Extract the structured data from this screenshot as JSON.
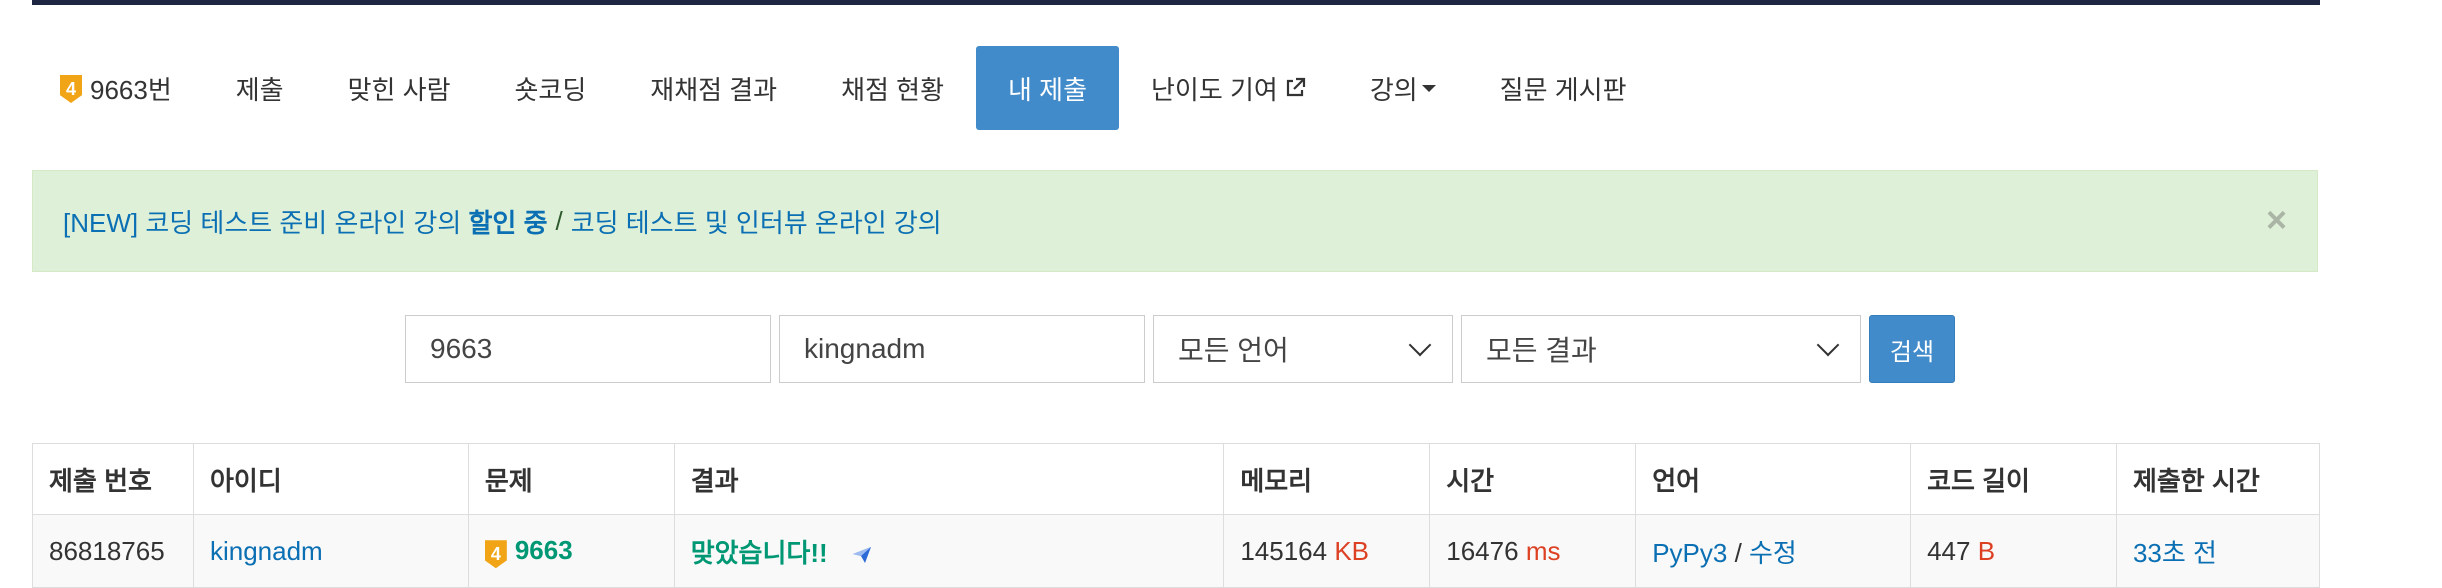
{
  "nav": {
    "problem_badge": "4",
    "problem": "9663번",
    "submit": "제출",
    "solvers": "맞힌 사람",
    "shortcoding": "숏코딩",
    "rejudge": "재채점 결과",
    "status": "채점 현황",
    "my_submit": "내 제출",
    "difficulty": "난이도 기여",
    "lecture": "강의",
    "board": "질문 게시판"
  },
  "alert": {
    "part1": "[NEW] 코딩 테스트 준비 온라인 강의 ",
    "part1_strong": "할인 중",
    "separator": "/",
    "part2": "코딩 테스트 및 인터뷰 온라인 강의",
    "close": "×"
  },
  "search": {
    "problem_id": "9663",
    "user_id": "kingnadm",
    "language": "모든 언어",
    "result": "모든 결과",
    "button": "검색"
  },
  "table": {
    "headers": [
      "제출 번호",
      "아이디",
      "문제",
      "결과",
      "메모리",
      "시간",
      "언어",
      "코드 길이",
      "제출한 시간"
    ],
    "row": {
      "id": "86818765",
      "user": "kingnadm",
      "problem_badge": "4",
      "problem": "9663",
      "result": "맞았습니다!!",
      "memory": "145164",
      "memory_unit": "KB",
      "time": "16476",
      "time_unit": "ms",
      "language": "PyPy3",
      "lang_sep": " / ",
      "edit": "수정",
      "code_length": "447",
      "code_unit": "B",
      "submitted": "33초 전"
    }
  },
  "colors": {
    "accent": "#428bca",
    "link": "#0a6fb3",
    "success": "#009874",
    "unit": "#dd4124",
    "tier_gold": "#f0a416"
  }
}
